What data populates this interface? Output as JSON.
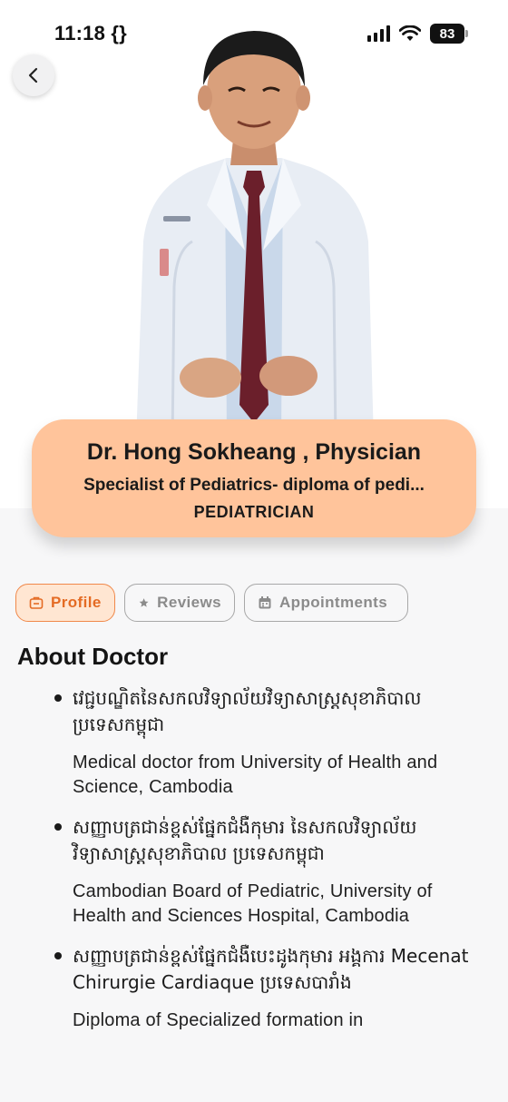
{
  "status_bar": {
    "time": "11:18 {}",
    "battery": "83"
  },
  "doctor": {
    "name": "Dr. Hong Sokheang , Physician",
    "specialty": "Specialist of Pediatrics- diploma of pedi...",
    "role": "PEDIATRICIAN"
  },
  "tabs": [
    {
      "label": "Profile",
      "icon": "briefcase-icon",
      "active": true
    },
    {
      "label": "Reviews",
      "icon": "star-icon",
      "active": false
    },
    {
      "label": "Appointments",
      "icon": "calendar-icon",
      "active": false
    }
  ],
  "about": {
    "title": "About Doctor",
    "items": [
      {
        "khmer": "វេជ្ជបណ្ឌិតនៃសកលវិទ្យាល័យវិទ្យាសាស្រ្តសុខាភិបាល ប្រទេសកម្ពុជា",
        "english": "Medical doctor from University of Health and Science, Cambodia"
      },
      {
        "khmer": "សញ្ញាបត្រជាន់ខ្ពស់ផ្នែកជំងឺកុមារ នៃសកលវិទ្យាល័យ វិទ្យាសាស្រ្តសុខាភិបាល ប្រទេសកម្ពុជា",
        "english": "Cambodian Board of Pediatric, University of Health and Sciences Hospital, Cambodia"
      },
      {
        "khmer": "សញ្ញាបត្រជាន់ខ្ពស់ផ្នែកជំងឺបេះដូងកុមារ អង្គការ Mecenat Chirurgie Cardiaque ប្រទេសបារាំង",
        "english": "Diploma of Specialized formation in"
      }
    ]
  },
  "colors": {
    "accent": "#e46b24",
    "card": "#ffc49b",
    "tab_active_bg": "#ffe6d2"
  }
}
